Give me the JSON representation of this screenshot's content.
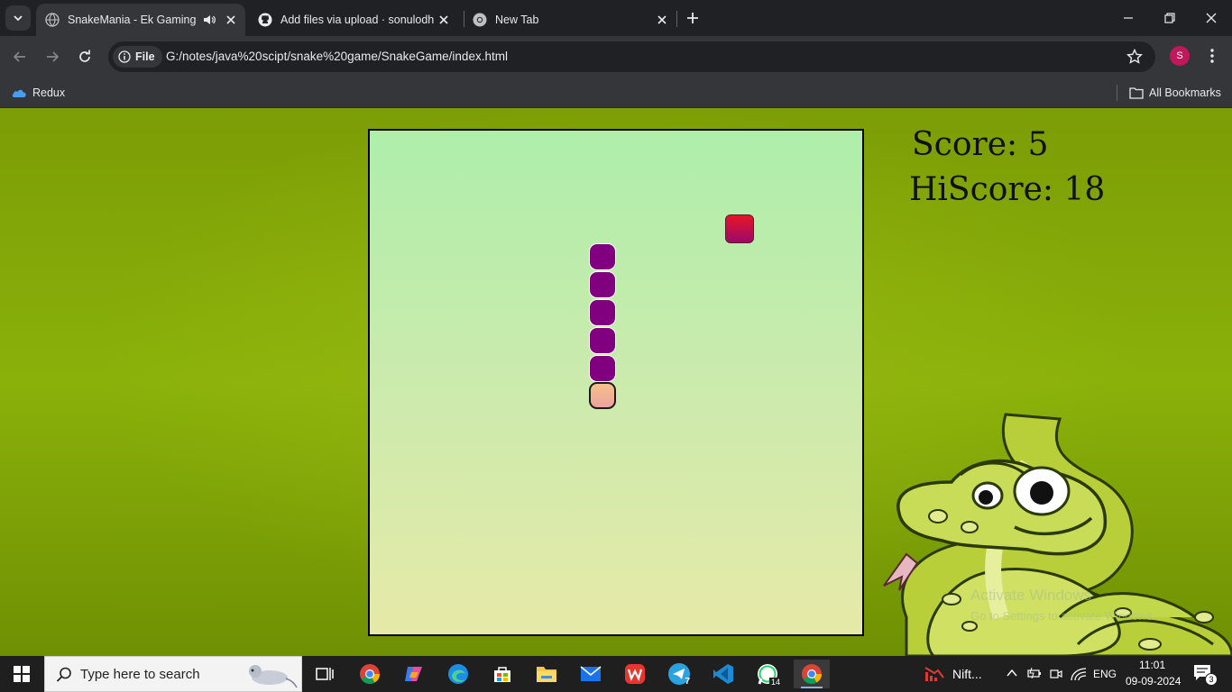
{
  "browser": {
    "tabs": [
      {
        "title": "SnakeMania - Ek Gaming Ka",
        "active": true
      },
      {
        "title": "Add files via upload · sonulodhi",
        "active": false
      },
      {
        "title": "New Tab",
        "active": false
      }
    ],
    "site_chip": "File",
    "url": "G:/notes/java%20scipt/snake%20game/SnakeGame/index.html",
    "profile_initial": "S",
    "bookmarks": [
      {
        "label": "Redux"
      }
    ],
    "all_bookmarks": "All Bookmarks"
  },
  "game": {
    "score_text": "Score: 5",
    "hiscore_text": "HiScore: 18",
    "score": 5,
    "hiscore": 18,
    "snake_length": 6,
    "colors": {
      "body": "#800080",
      "food": "#e81527",
      "board": "#c8ebad",
      "background": "#84a808"
    }
  },
  "watermark": {
    "line1": "Activate Windows",
    "line2": "Go to Settings to activate Windows."
  },
  "taskbar": {
    "search_placeholder": "Type here to search",
    "telegram_badge": "7",
    "whatsapp_badge": "14",
    "stock_label": "Nift...",
    "lang": "ENG",
    "time": "11:01",
    "date": "09-09-2024",
    "notification_count": "3"
  }
}
